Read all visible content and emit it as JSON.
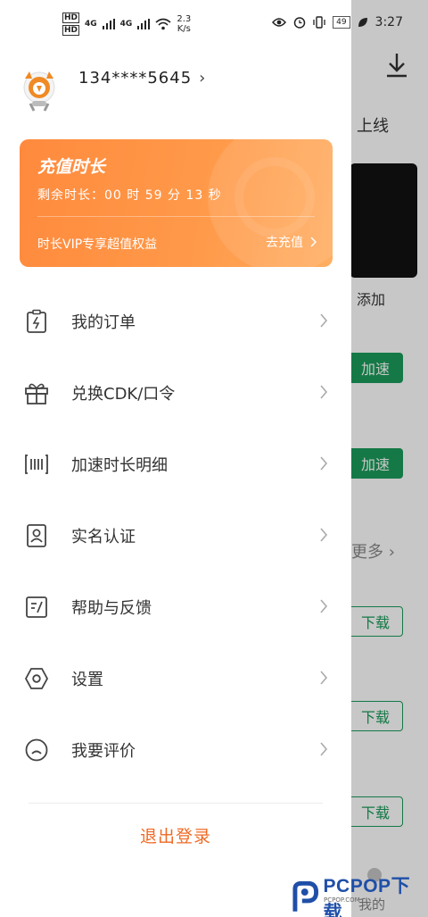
{
  "status_bar": {
    "network_left": "HD",
    "signal_1": "4G",
    "signal_2": "4G",
    "net_speed_value": "2.3",
    "net_speed_unit": "K/s",
    "battery": "49",
    "time": "3:27"
  },
  "background_app": {
    "header_text": "上线",
    "add_label": "添加",
    "accelerate_1": "加速",
    "accelerate_2": "加速",
    "more_label": "更多",
    "download_1": "下载",
    "download_2": "下载",
    "download_3": "下载",
    "tab_mine": "我的"
  },
  "profile": {
    "phone": "134****5645"
  },
  "vip_card": {
    "title": "充值时长",
    "remaining": "剩余时长：00 时 59 分 13 秒",
    "benefit": "时长VIP专享超值权益",
    "recharge": "去充值"
  },
  "menu": {
    "items": [
      {
        "label": "我的订单",
        "icon": "order-icon"
      },
      {
        "label": "兑换CDK/口令",
        "icon": "gift-icon"
      },
      {
        "label": "加速时长明细",
        "icon": "accelerate-detail-icon"
      },
      {
        "label": "实名认证",
        "icon": "id-card-icon"
      },
      {
        "label": "帮助与反馈",
        "icon": "feedback-icon"
      },
      {
        "label": "设置",
        "icon": "settings-icon"
      },
      {
        "label": "我要评价",
        "icon": "rate-icon"
      }
    ]
  },
  "logout": "退出登录",
  "watermark": {
    "brand": "PCPOP下载",
    "sub": "PCPOP.COM"
  },
  "colors": {
    "accent": "#ef6a24",
    "vip_gradient_start": "#ff8a3d",
    "vip_gradient_end": "#ffae62",
    "green": "#1a9c5a"
  }
}
